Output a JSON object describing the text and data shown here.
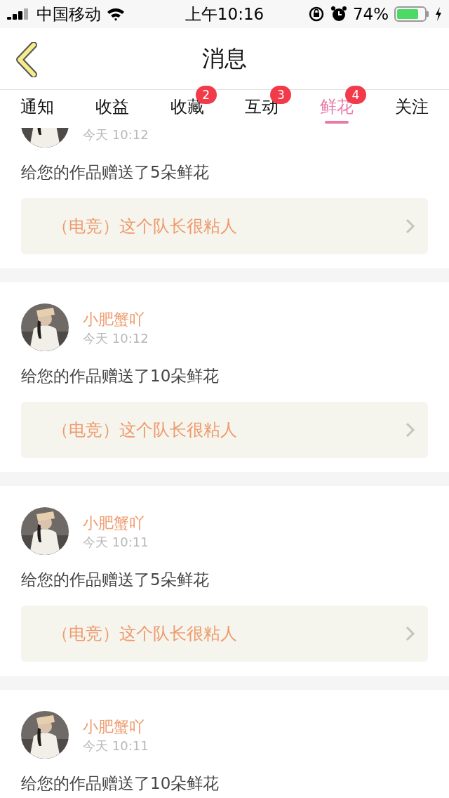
{
  "status_bar": {
    "carrier": "中国移动",
    "time": "上午10:16",
    "battery": "74%"
  },
  "header": {
    "title": "消息"
  },
  "tabs": [
    {
      "label": "通知",
      "selected": false
    },
    {
      "label": "收益",
      "selected": false
    },
    {
      "label": "收藏",
      "selected": false,
      "badge": "2"
    },
    {
      "label": "互动",
      "selected": false,
      "badge": "3"
    },
    {
      "label": "鲜花",
      "selected": true,
      "badge": "4"
    },
    {
      "label": "关注",
      "selected": false
    }
  ],
  "messages": [
    {
      "time": "今天 10:12",
      "text": "给您的作品赠送了5朵鲜花",
      "work": "（电竞）这个队长很粘人"
    },
    {
      "name": "小肥蟹吖",
      "time": "今天 10:12",
      "text": "给您的作品赠送了10朵鲜花",
      "work": "（电竞）这个队长很粘人"
    },
    {
      "name": "小肥蟹吖",
      "time": "今天 10:11",
      "text": "给您的作品赠送了5朵鲜花",
      "work": "（电竞）这个队长很粘人"
    },
    {
      "name": "小肥蟹吖",
      "time": "今天 10:11",
      "text": "给您的作品赠送了10朵鲜花"
    }
  ]
}
